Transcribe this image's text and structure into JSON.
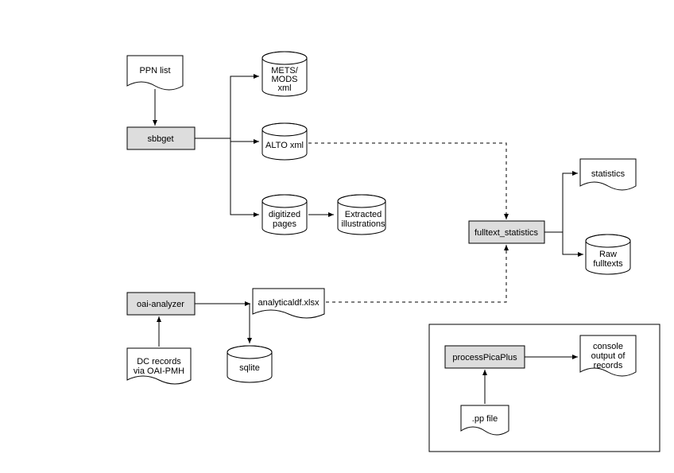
{
  "nodes": {
    "ppn": {
      "text": "PPN list"
    },
    "sbbget": {
      "text": "sbbget"
    },
    "mets": {
      "line1": "METS/",
      "line2": "MODS",
      "line3": "xml"
    },
    "alto": {
      "text": "ALTO xml"
    },
    "digitized": {
      "line1": "digitized",
      "line2": "pages"
    },
    "extracted": {
      "line1": "Extracted",
      "line2": "illustrations"
    },
    "oai": {
      "text": "oai-analyzer"
    },
    "analytical": {
      "text": "analyticaldf.xlsx"
    },
    "dc": {
      "line1": "DC records",
      "line2": "via OAI-PMH"
    },
    "sqlite": {
      "text": "sqlite"
    },
    "fulltext": {
      "text": "fulltext_statistics"
    },
    "stats": {
      "text": "statistics"
    },
    "raw": {
      "line1": "Raw",
      "line2": "fulltexts"
    },
    "ppp": {
      "text": "processPicaPlus"
    },
    "console": {
      "line1": "console",
      "line2": "output of",
      "line3": "records"
    },
    "ppfile": {
      "text": ".pp file"
    }
  },
  "chart_data": {
    "type": "table",
    "description": "Flow diagram of data-processing tools",
    "nodes": [
      {
        "id": "ppn",
        "label": "PPN list",
        "shape": "document"
      },
      {
        "id": "sbbget",
        "label": "sbbget",
        "shape": "process"
      },
      {
        "id": "mets",
        "label": "METS/ MODS xml",
        "shape": "cylinder"
      },
      {
        "id": "alto",
        "label": "ALTO xml",
        "shape": "cylinder"
      },
      {
        "id": "digitized",
        "label": "digitized pages",
        "shape": "cylinder"
      },
      {
        "id": "extracted",
        "label": "Extracted illustrations",
        "shape": "cylinder"
      },
      {
        "id": "oai",
        "label": "oai-analyzer",
        "shape": "process"
      },
      {
        "id": "analytical",
        "label": "analyticaldf.xlsx",
        "shape": "document"
      },
      {
        "id": "dc",
        "label": "DC records via OAI-PMH",
        "shape": "document"
      },
      {
        "id": "sqlite",
        "label": "sqlite",
        "shape": "cylinder"
      },
      {
        "id": "fulltext",
        "label": "fulltext_statistics",
        "shape": "process"
      },
      {
        "id": "stats",
        "label": "statistics",
        "shape": "document"
      },
      {
        "id": "raw",
        "label": "Raw fulltexts",
        "shape": "cylinder"
      },
      {
        "id": "ppp",
        "label": "processPicaPlus",
        "shape": "process"
      },
      {
        "id": "console",
        "label": "console output of records",
        "shape": "document"
      },
      {
        "id": "ppfile",
        "label": ".pp file",
        "shape": "document"
      }
    ],
    "edges": [
      {
        "from": "ppn",
        "to": "sbbget",
        "style": "solid"
      },
      {
        "from": "sbbget",
        "to": "mets",
        "style": "solid"
      },
      {
        "from": "sbbget",
        "to": "alto",
        "style": "solid"
      },
      {
        "from": "sbbget",
        "to": "digitized",
        "style": "solid"
      },
      {
        "from": "digitized",
        "to": "extracted",
        "style": "solid"
      },
      {
        "from": "dc",
        "to": "oai",
        "style": "solid"
      },
      {
        "from": "oai",
        "to": "analytical",
        "style": "solid"
      },
      {
        "from": "oai",
        "to": "sqlite",
        "style": "solid"
      },
      {
        "from": "alto",
        "to": "fulltext",
        "style": "dashed"
      },
      {
        "from": "analytical",
        "to": "fulltext",
        "style": "dashed"
      },
      {
        "from": "fulltext",
        "to": "stats",
        "style": "solid"
      },
      {
        "from": "fulltext",
        "to": "raw",
        "style": "solid"
      },
      {
        "from": "ppfile",
        "to": "ppp",
        "style": "solid"
      },
      {
        "from": "ppp",
        "to": "console",
        "style": "solid"
      }
    ],
    "containers": [
      {
        "label": "",
        "contains": [
          "ppp",
          "console",
          "ppfile"
        ]
      }
    ]
  }
}
